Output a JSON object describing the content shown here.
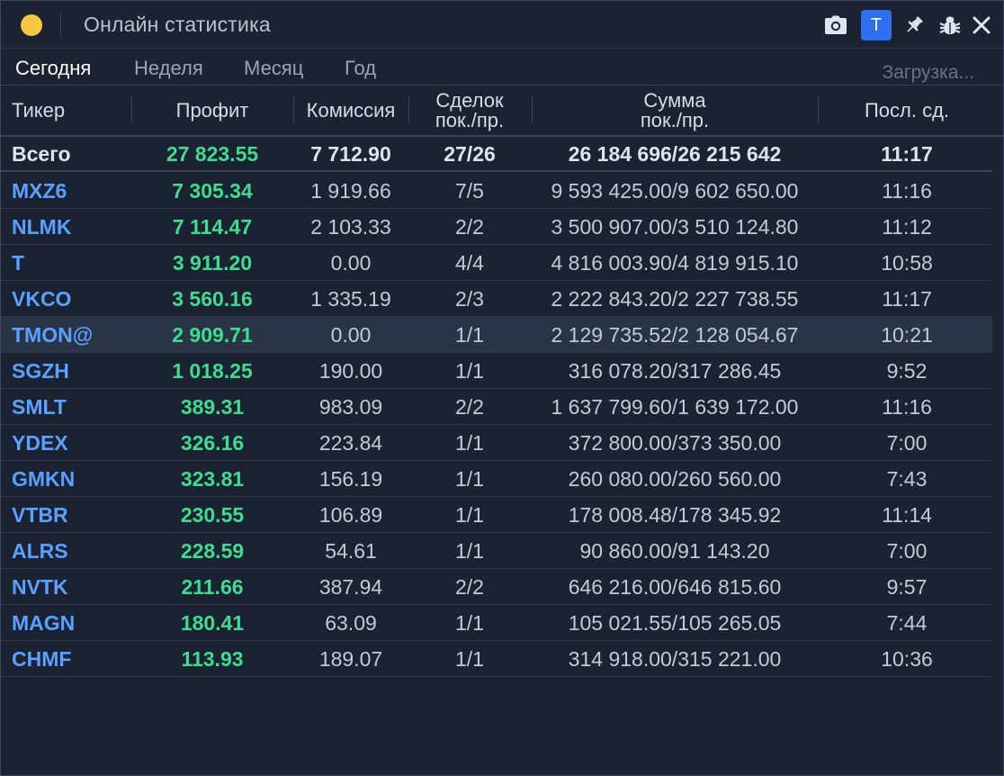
{
  "window": {
    "title": "Онлайн статистика",
    "badge": "T",
    "status_color": "#f5c842",
    "accent": "#2e6ff0"
  },
  "icons": [
    "camera-icon",
    "pin-icon",
    "bug-icon",
    "close-icon"
  ],
  "tabs": [
    {
      "label": "Сегодня",
      "active": true
    },
    {
      "label": "Неделя",
      "active": false
    },
    {
      "label": "Месяц",
      "active": false
    },
    {
      "label": "Год",
      "active": false
    }
  ],
  "loading": "Загрузка...",
  "columns": {
    "ticker": "Тикер",
    "profit": "Профит",
    "commission": "Комиссия",
    "deals_1": "Сделок",
    "deals_2": "пок./пр.",
    "sum_1": "Сумма",
    "sum_2": "пок./пр.",
    "last": "Посл. сд."
  },
  "total": {
    "ticker": "Всего",
    "profit": "27 823.55",
    "commission": "7 712.90",
    "deals": "27/26",
    "sum": "26 184 696/26 215 642",
    "last": "11:17"
  },
  "rows": [
    {
      "ticker": "MXZ6",
      "profit": "7 305.34",
      "commission": "1 919.66",
      "deals": "7/5",
      "sum": "9 593 425.00/9 602 650.00",
      "last": "11:16"
    },
    {
      "ticker": "NLMK",
      "profit": "7 114.47",
      "commission": "2 103.33",
      "deals": "2/2",
      "sum": "3 500 907.00/3 510 124.80",
      "last": "11:12"
    },
    {
      "ticker": "T",
      "profit": "3 911.20",
      "commission": "0.00",
      "deals": "4/4",
      "sum": "4 816 003.90/4 819 915.10",
      "last": "10:58"
    },
    {
      "ticker": "VKCO",
      "profit": "3 560.16",
      "commission": "1 335.19",
      "deals": "2/3",
      "sum": "2 222 843.20/2 227 738.55",
      "last": "11:17"
    },
    {
      "ticker": "TMON@",
      "profit": "2 909.71",
      "commission": "0.00",
      "deals": "1/1",
      "sum": "2 129 735.52/2 128 054.67",
      "last": "10:21"
    },
    {
      "ticker": "SGZH",
      "profit": "1 018.25",
      "commission": "190.00",
      "deals": "1/1",
      "sum": "316 078.20/317 286.45",
      "last": "9:52"
    },
    {
      "ticker": "SMLT",
      "profit": "389.31",
      "commission": "983.09",
      "deals": "2/2",
      "sum": "1 637 799.60/1 639 172.00",
      "last": "11:16"
    },
    {
      "ticker": "YDEX",
      "profit": "326.16",
      "commission": "223.84",
      "deals": "1/1",
      "sum": "372 800.00/373 350.00",
      "last": "7:00"
    },
    {
      "ticker": "GMKN",
      "profit": "323.81",
      "commission": "156.19",
      "deals": "1/1",
      "sum": "260 080.00/260 560.00",
      "last": "7:43"
    },
    {
      "ticker": "VTBR",
      "profit": "230.55",
      "commission": "106.89",
      "deals": "1/1",
      "sum": "178 008.48/178 345.92",
      "last": "11:14"
    },
    {
      "ticker": "ALRS",
      "profit": "228.59",
      "commission": "54.61",
      "deals": "1/1",
      "sum": "90 860.00/91 143.20",
      "last": "7:00"
    },
    {
      "ticker": "NVTK",
      "profit": "211.66",
      "commission": "387.94",
      "deals": "2/2",
      "sum": "646 216.00/646 815.60",
      "last": "9:57"
    },
    {
      "ticker": "MAGN",
      "profit": "180.41",
      "commission": "63.09",
      "deals": "1/1",
      "sum": "105 021.55/105 265.05",
      "last": "7:44"
    },
    {
      "ticker": "CHMF",
      "profit": "113.93",
      "commission": "189.07",
      "deals": "1/1",
      "sum": "314 918.00/315 221.00",
      "last": "10:36"
    }
  ]
}
